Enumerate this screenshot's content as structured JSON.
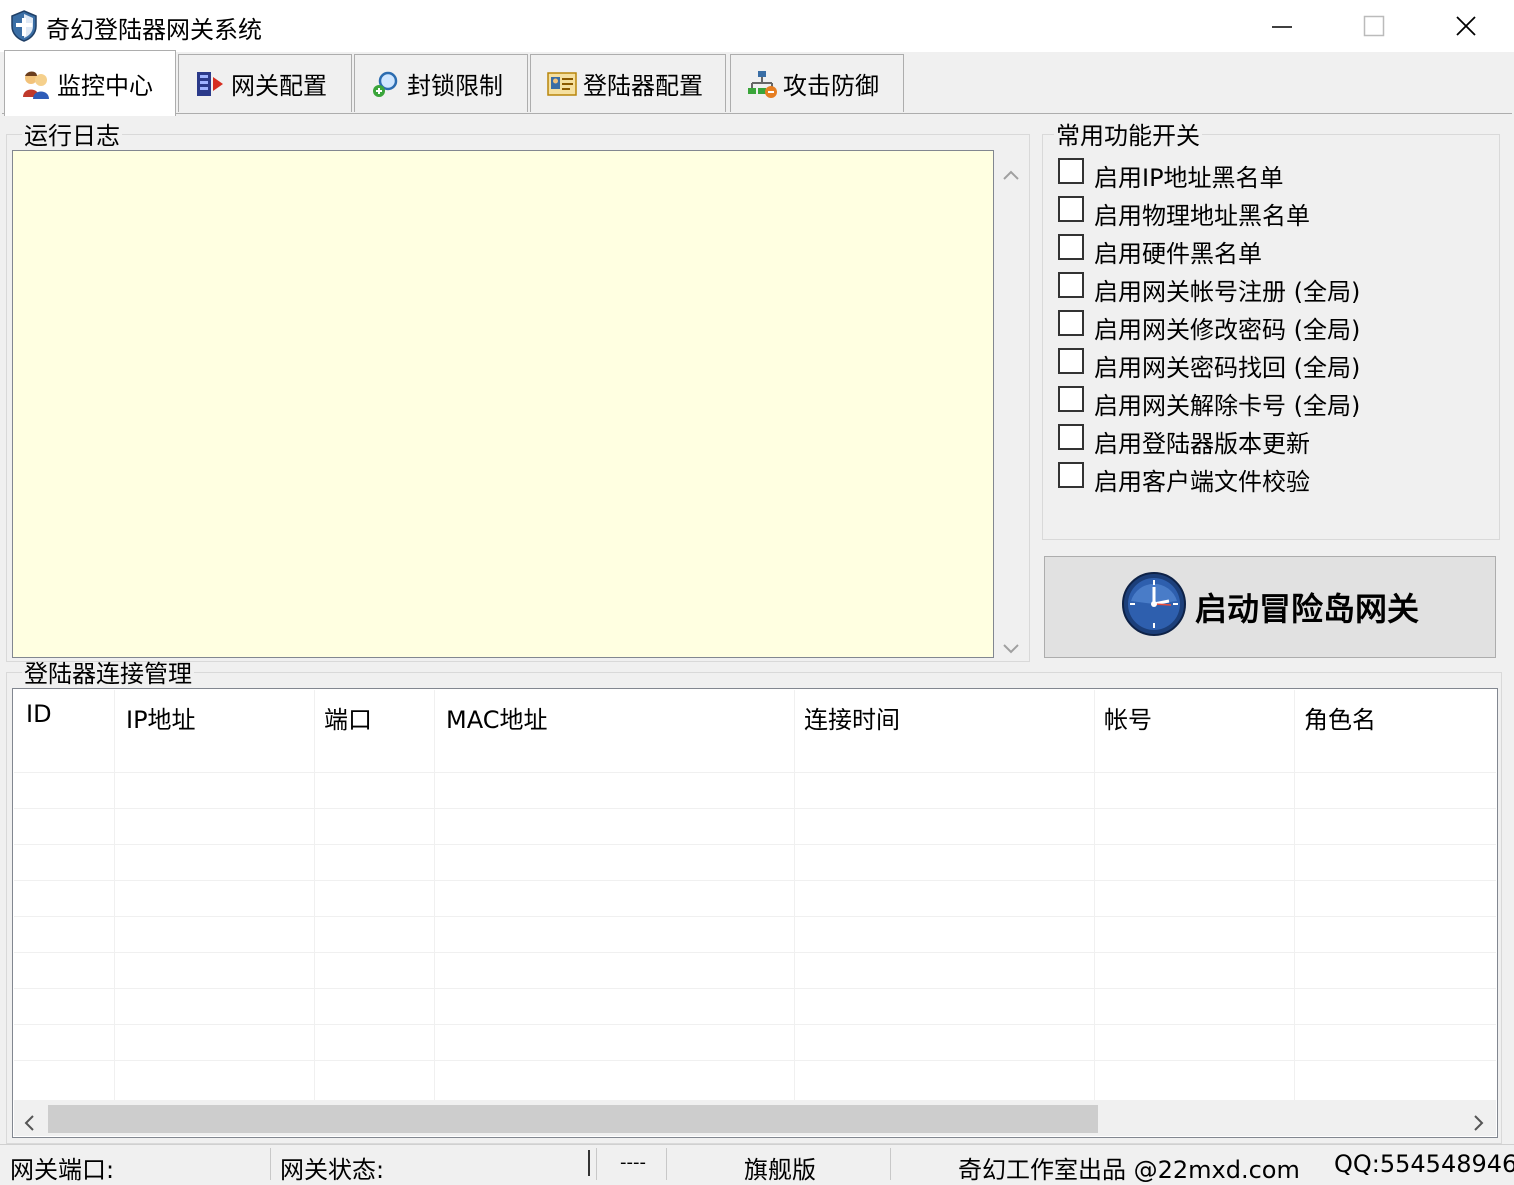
{
  "window": {
    "title": "奇幻登陆器网关系统"
  },
  "tabs": [
    {
      "label": "监控中心",
      "icon": "users-icon",
      "active": true
    },
    {
      "label": "网关配置",
      "icon": "gateway-config-icon"
    },
    {
      "label": "封锁限制",
      "icon": "search-block-icon"
    },
    {
      "label": "登陆器配置",
      "icon": "launcher-config-icon"
    },
    {
      "label": "攻击防御",
      "icon": "network-defense-icon"
    }
  ],
  "log": {
    "title": "运行日志"
  },
  "features": {
    "title": "常用功能开关",
    "items": [
      {
        "label": "启用IP地址黑名单",
        "checked": false
      },
      {
        "label": "启用物理地址黑名单",
        "checked": false
      },
      {
        "label": "启用硬件黑名单",
        "checked": false
      },
      {
        "label": "启用网关帐号注册 (全局)",
        "checked": false
      },
      {
        "label": "启用网关修改密码 (全局)",
        "checked": false
      },
      {
        "label": "启用网关密码找回 (全局)",
        "checked": false
      },
      {
        "label": "启用网关解除卡号 (全局)",
        "checked": false
      },
      {
        "label": "启用登陆器版本更新",
        "checked": false
      },
      {
        "label": "启用客户端文件校验",
        "checked": false
      }
    ]
  },
  "start_button": {
    "label": "启动冒险岛网关",
    "icon": "clock-icon"
  },
  "connections": {
    "title": "登陆器连接管理",
    "columns": [
      "ID",
      "IP地址",
      "端口",
      "MAC地址",
      "连接时间",
      "帐号",
      "角色名"
    ],
    "rows": []
  },
  "status": {
    "port_label": "网关端口:",
    "state_label": "网关状态:",
    "dashes": "----",
    "edition": "旗舰版",
    "credit": "奇幻工作室出品 @22mxd.com",
    "qq": "QQ:554548946"
  }
}
